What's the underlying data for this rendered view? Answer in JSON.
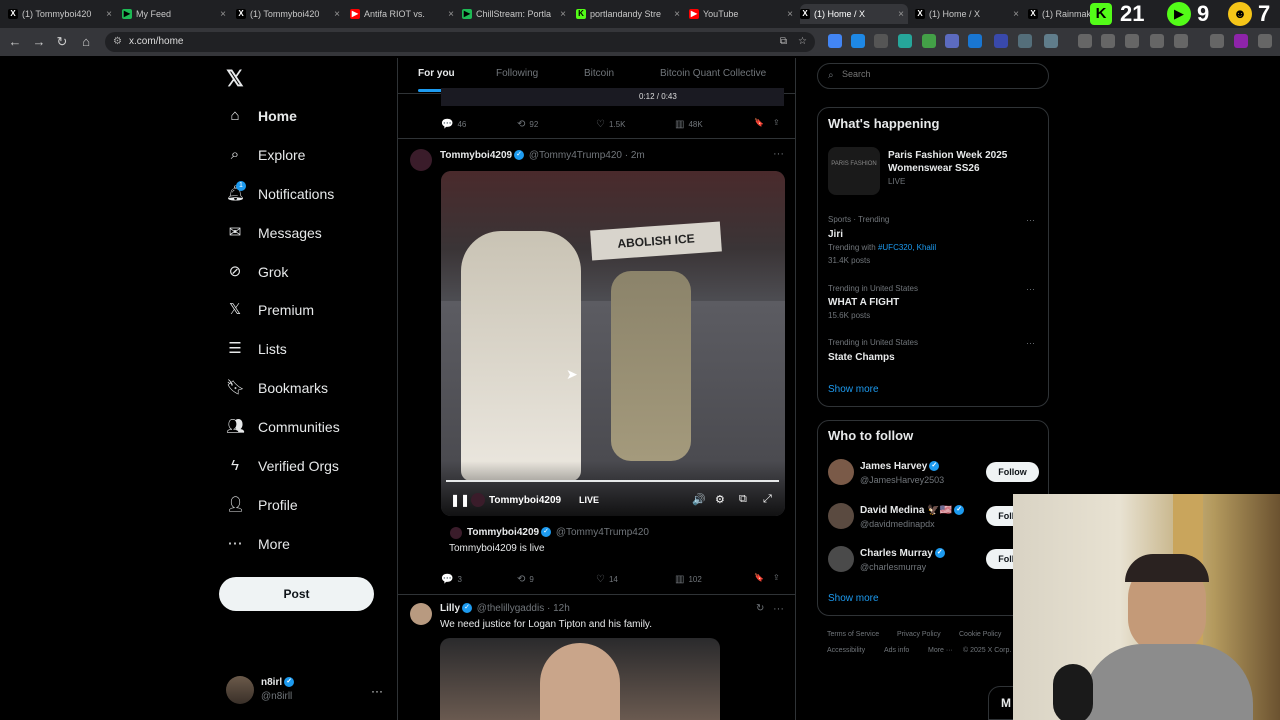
{
  "browser": {
    "tabs": [
      {
        "label": "(1) Tommyboi420",
        "icon": "x-logo-icon"
      },
      {
        "label": "My Feed",
        "icon": "play-icon"
      },
      {
        "label": "(1) Tommyboi420",
        "icon": "x-logo-icon"
      },
      {
        "label": "Antifa RIOT vs.",
        "icon": "youtube-icon"
      },
      {
        "label": "ChillStream: Portla",
        "icon": "play-icon"
      },
      {
        "label": "portlandandy Stre",
        "icon": "kick-icon"
      },
      {
        "label": "YouTube",
        "icon": "youtube-icon"
      },
      {
        "label": "(1) Home / X",
        "icon": "x-logo-icon"
      },
      {
        "label": "(1) Home / X",
        "icon": "x-logo-icon"
      },
      {
        "label": "(1) Rainmake",
        "icon": "x-logo-icon"
      }
    ],
    "url": "x.com/home",
    "overlay_numbers": [
      "21",
      "9",
      "7"
    ]
  },
  "sidebar": {
    "items": [
      {
        "label": "Home",
        "icon": "home-icon"
      },
      {
        "label": "Explore",
        "icon": "search-icon"
      },
      {
        "label": "Notifications",
        "icon": "bell-icon",
        "badge": "1"
      },
      {
        "label": "Messages",
        "icon": "mail-icon"
      },
      {
        "label": "Grok",
        "icon": "grok-icon"
      },
      {
        "label": "Premium",
        "icon": "x-logo-icon"
      },
      {
        "label": "Lists",
        "icon": "list-icon"
      },
      {
        "label": "Bookmarks",
        "icon": "bookmark-icon"
      },
      {
        "label": "Communities",
        "icon": "people-icon"
      },
      {
        "label": "Verified Orgs",
        "icon": "lightning-icon"
      },
      {
        "label": "Profile",
        "icon": "person-icon"
      },
      {
        "label": "More",
        "icon": "more-circle-icon"
      }
    ],
    "post_label": "Post",
    "account": {
      "name": "n8irl",
      "handle": "@n8irll"
    }
  },
  "feed": {
    "tabs": [
      "For you",
      "Following",
      "Bitcoin",
      "Bitcoin Quant Collective"
    ],
    "prev_post": {
      "replies": "46",
      "reposts": "92",
      "likes": "1.5K",
      "views": "48K",
      "time": "0:12 / 0:43"
    },
    "post1": {
      "name": "Tommyboi4209",
      "handle": "@Tommy4Trump420",
      "time": "· 2m",
      "video_name": "Tommyboi4209",
      "live_label": "LIVE",
      "video_sign": "ABOLISH ICE",
      "quote_name": "Tommyboi4209",
      "quote_handle": "@Tommy4Trump420",
      "quote_text": "Tommyboi4209 is live",
      "replies": "3",
      "reposts": "9",
      "likes": "14",
      "views": "102"
    },
    "post2": {
      "name": "Lilly",
      "handle": "@thelillygaddis",
      "time": "· 12h",
      "text": "We need justice for Logan Tipton and his family."
    }
  },
  "right": {
    "search_placeholder": "Search",
    "happening_title": "What's happening",
    "event": {
      "title": "Paris Fashion Week 2025 Womenswear SS26",
      "status": "LIVE",
      "thumb_text": "PARIS FASHION"
    },
    "trends": [
      {
        "meta": "Sports · Trending",
        "title": "Jiri",
        "extra_prefix": "Trending with ",
        "extra_link": "#UFC320, Khalil",
        "posts": "31.4K posts"
      },
      {
        "meta": "Trending in United States",
        "title": "WHAT A FIGHT",
        "posts": "15.6K posts"
      },
      {
        "meta": "Trending in United States",
        "title": "State Champs",
        "posts": ""
      }
    ],
    "show_more": "Show more",
    "who_to_follow_title": "Who to follow",
    "follow_suggestions": [
      {
        "name": "James Harvey",
        "handle": "@JamesHarvey2503",
        "button": "Follow"
      },
      {
        "name": "David Medina 🦅🇺🇸",
        "handle": "@davidmedinapdx",
        "button": "Follow"
      },
      {
        "name": "Charles Murray",
        "handle": "@charlesmurray",
        "button": "Follow"
      }
    ],
    "show_more_2": "Show more",
    "footer": [
      "Terms of Service",
      "Privacy Policy",
      "Cookie Policy",
      "Accessibility",
      "Ads info",
      "More ···",
      "© 2025 X Corp."
    ],
    "messages_label": "M"
  },
  "colors": {
    "accent": "#1d9bf0",
    "background": "#000000",
    "border": "#2f3336",
    "muted": "#71767b"
  }
}
